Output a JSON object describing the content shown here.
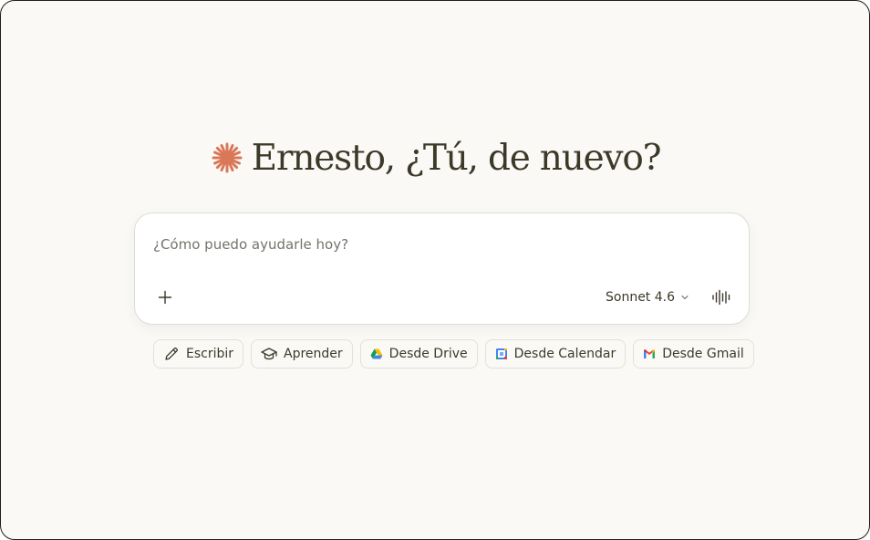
{
  "greeting": {
    "text": "Ernesto, ¿Tú, de nuevo?",
    "logo_icon": "spark-icon",
    "logo_color": "#d97757"
  },
  "composer": {
    "placeholder": "¿Cómo puedo ayudarle hoy?",
    "value": "",
    "add_icon": "plus-icon",
    "model_label": "Sonnet 4.6",
    "model_icon": "chevron-down-icon",
    "voice_icon": "voice-waveform-icon"
  },
  "chips": [
    {
      "label": "Escribir",
      "icon": "pencil-icon"
    },
    {
      "label": "Aprender",
      "icon": "graduation-cap-icon"
    },
    {
      "label": "Desde Drive",
      "icon": "google-drive-icon"
    },
    {
      "label": "Desde Calendar",
      "icon": "google-calendar-icon"
    },
    {
      "label": "Desde Gmail",
      "icon": "gmail-icon"
    }
  ],
  "colors": {
    "background": "#faf9f5",
    "text": "#3d3929",
    "accent": "#d97757"
  }
}
